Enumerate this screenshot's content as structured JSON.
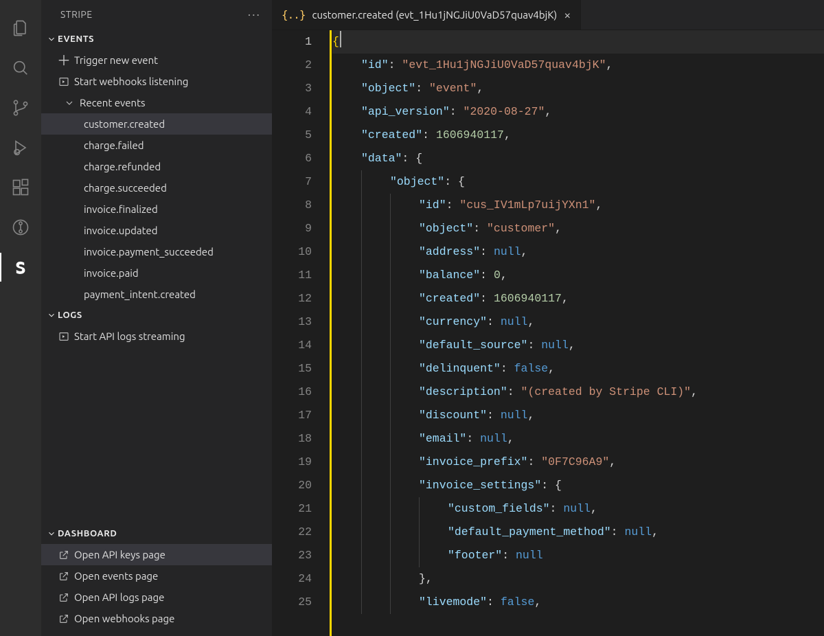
{
  "activitybar": {
    "items": [
      {
        "name": "explorer",
        "active": false
      },
      {
        "name": "search",
        "active": false
      },
      {
        "name": "source-control",
        "active": false
      },
      {
        "name": "run-debug",
        "active": false
      },
      {
        "name": "extensions",
        "active": false
      },
      {
        "name": "git-graph",
        "active": false
      },
      {
        "name": "stripe",
        "active": true
      }
    ]
  },
  "sidebar": {
    "title": "STRIPE",
    "events_header": "EVENTS",
    "trigger_label": "Trigger new event",
    "webhooks_label": "Start webhooks listening",
    "recent_header": "Recent events",
    "recent_events": [
      "customer.created",
      "charge.failed",
      "charge.refunded",
      "charge.succeeded",
      "invoice.finalized",
      "invoice.updated",
      "invoice.payment_succeeded",
      "invoice.paid",
      "payment_intent.created"
    ],
    "selected_event_index": 0,
    "logs_header": "LOGS",
    "logs_start_label": "Start API logs streaming",
    "dashboard_header": "DASHBOARD",
    "dashboard_items": [
      "Open API keys page",
      "Open events page",
      "Open API logs page",
      "Open webhooks page"
    ],
    "dashboard_selected_index": 0
  },
  "tab": {
    "icon_text": "{..}",
    "title": "customer.created (evt_1Hu1jNGJiU0VaD57quav4bjK)"
  },
  "editor": {
    "event": {
      "id": "evt_1Hu1jNGJiU0VaD57quav4bjK",
      "object": "event",
      "api_version": "2020-08-27",
      "created": 1606940117,
      "data": {
        "object": {
          "id": "cus_IV1mLp7uijYXn1",
          "object": "customer",
          "address": null,
          "balance": 0,
          "created": 1606940117,
          "currency": null,
          "default_source": null,
          "delinquent": false,
          "description": "(created by Stripe CLI)",
          "discount": null,
          "email": null,
          "invoice_prefix": "0F7C96A9",
          "invoice_settings": {
            "custom_fields": null,
            "default_payment_method": null,
            "footer": null
          },
          "livemode": false
        }
      }
    },
    "active_line": 1,
    "visible_lines": 25
  }
}
